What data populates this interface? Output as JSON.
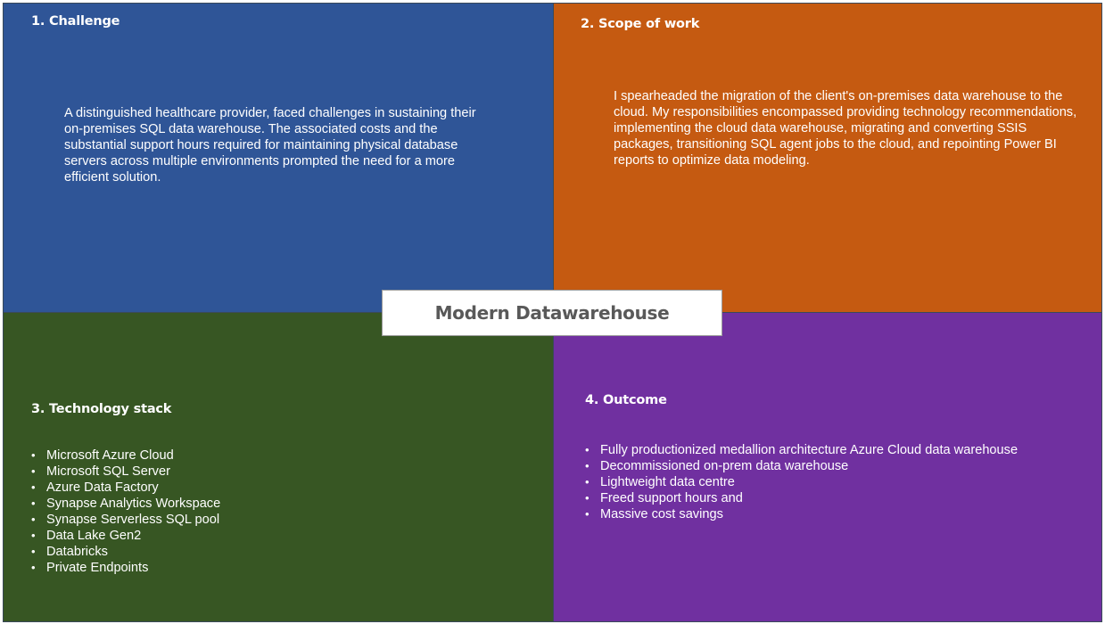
{
  "center_title": "Modern Datawarehouse",
  "challenge": {
    "heading": "1. Challenge",
    "text": "A distinguished healthcare provider, faced challenges in sustaining their on-premises SQL data warehouse. The associated costs and the substantial support hours required for maintaining physical database servers across multiple environments prompted the need for a more efficient solution."
  },
  "scope": {
    "heading": "2. Scope of work",
    "text": "I spearheaded the migration of the client's on-premises data warehouse to the cloud. My responsibilities encompassed providing technology recommendations, implementing the cloud data warehouse, migrating and converting SSIS packages, transitioning SQL agent jobs to the cloud, and repointing Power BI reports to optimize data modeling."
  },
  "tech": {
    "heading": "3. Technology stack",
    "items": [
      "Microsoft Azure Cloud",
      "Microsoft SQL Server",
      "Azure Data Factory",
      "Synapse Analytics Workspace",
      "Synapse Serverless SQL pool",
      "Data Lake Gen2",
      "Databricks",
      "Private Endpoints"
    ]
  },
  "outcome": {
    "heading": "4. Outcome",
    "items": [
      "Fully productionized medallion architecture Azure Cloud data warehouse",
      "Decommissioned on-prem data warehouse",
      "Lightweight data centre",
      "Freed support hours and",
      "Massive cost savings"
    ]
  },
  "colors": {
    "challenge_bg": "#2f5597",
    "scope_bg": "#c55a11",
    "tech_bg": "#375623",
    "outcome_bg": "#7030a0"
  }
}
